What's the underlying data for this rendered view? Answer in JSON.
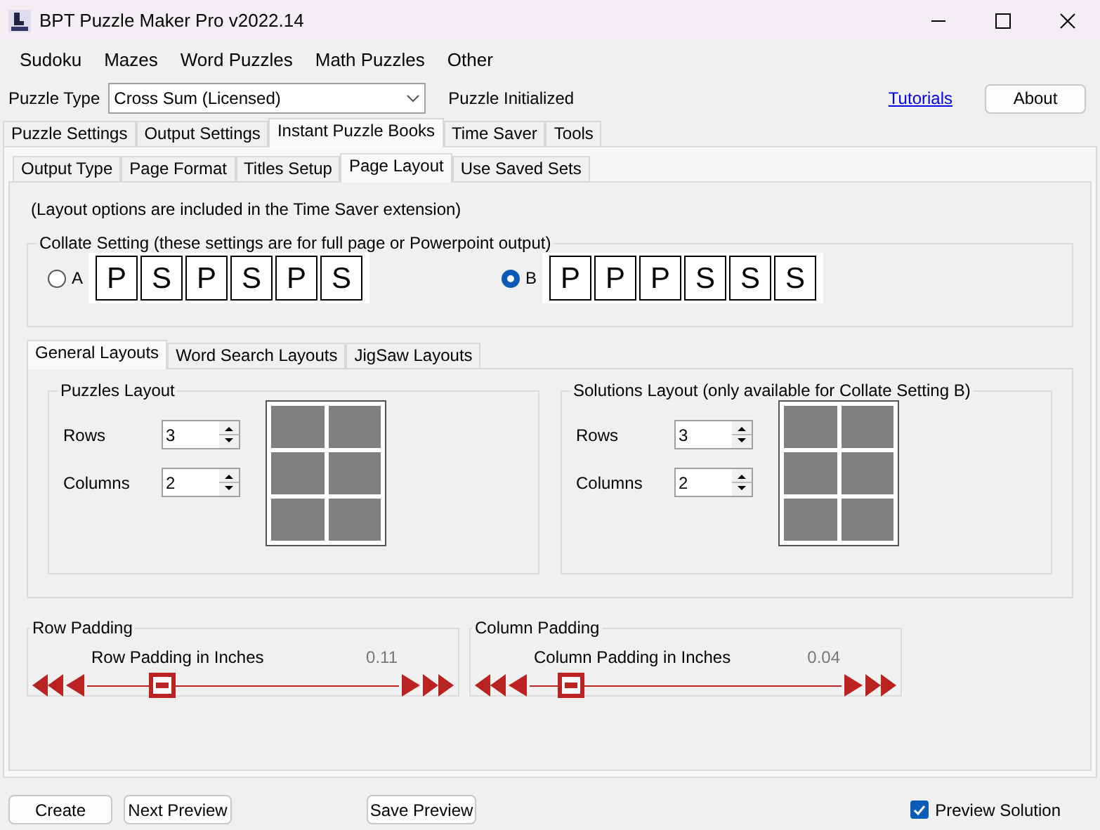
{
  "window": {
    "title": "BPT Puzzle Maker Pro v2022.14"
  },
  "menu": [
    "Sudoku",
    "Mazes",
    "Word Puzzles",
    "Math Puzzles",
    "Other"
  ],
  "toolbar": {
    "puzzle_type_label": "Puzzle Type",
    "puzzle_type": "Cross Sum (Licensed)",
    "status": "Puzzle Initialized",
    "tutorials_link": "Tutorials",
    "about_button": "About"
  },
  "main_tabs": [
    {
      "label": "Puzzle Settings",
      "selected": false
    },
    {
      "label": "Output Settings",
      "selected": false
    },
    {
      "label": "Instant Puzzle Books",
      "selected": true
    },
    {
      "label": "Time Saver",
      "selected": false
    },
    {
      "label": "Tools",
      "selected": false
    }
  ],
  "sub_tabs": [
    {
      "label": "Output Type",
      "selected": false
    },
    {
      "label": "Page Format",
      "selected": false
    },
    {
      "label": "Titles Setup",
      "selected": false
    },
    {
      "label": "Page Layout",
      "selected": true
    },
    {
      "label": "Use Saved Sets",
      "selected": false
    }
  ],
  "note": "(Layout options are included in the Time Saver extension)",
  "collate": {
    "legend": "Collate Setting (these settings are for full page or Powerpoint output)",
    "options": [
      {
        "label": "A",
        "selected": false,
        "cells": [
          "P",
          "S",
          "P",
          "S",
          "P",
          "S"
        ]
      },
      {
        "label": "B",
        "selected": true,
        "cells": [
          "P",
          "P",
          "P",
          "S",
          "S",
          "S"
        ]
      }
    ]
  },
  "layout_tabs": [
    {
      "label": "General Layouts",
      "selected": true
    },
    {
      "label": "Word Search Layouts",
      "selected": false
    },
    {
      "label": "JigSaw Layouts",
      "selected": false
    }
  ],
  "layout_groups": [
    {
      "legend": "Puzzles Layout",
      "rows_label": "Rows",
      "rows": "3",
      "columns_label": "Columns",
      "columns": "2"
    },
    {
      "legend": "Solutions Layout (only available for Collate Setting B)",
      "rows_label": "Rows",
      "rows": "3",
      "columns_label": "Columns",
      "columns": "2"
    }
  ],
  "padding_groups": [
    {
      "legend": "Row Padding",
      "label": "Row Padding in Inches",
      "reading": "0.11",
      "level": 0.24
    },
    {
      "legend": "Column Padding",
      "label": "Column Padding in Inches",
      "reading": "0.04",
      "level": 0.13
    }
  ],
  "bottom": {
    "buttons": [
      "Create",
      "Next Preview"
    ],
    "save_button": "Save Preview",
    "preview_solution": {
      "label": "Preview Solution",
      "checked": true
    }
  }
}
